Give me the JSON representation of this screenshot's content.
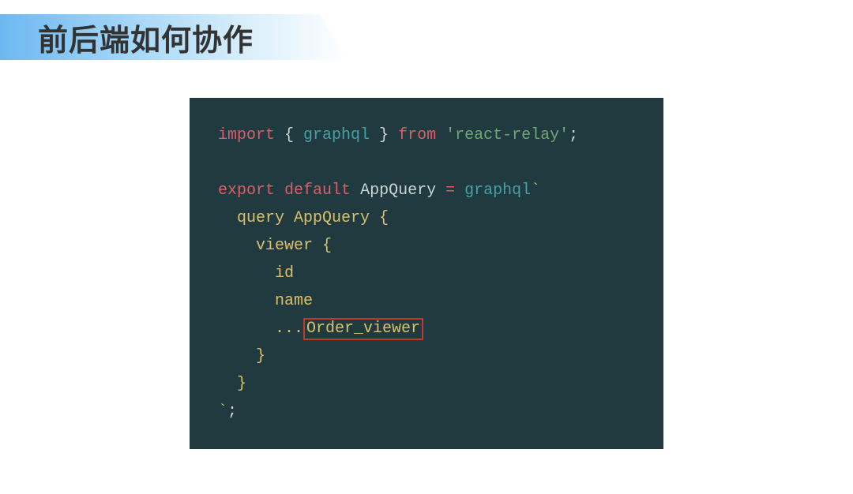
{
  "header": {
    "title": "前后端如何协作"
  },
  "code": {
    "line1_import": "import",
    "line1_brace_open": " { ",
    "line1_graphql": "graphql",
    "line1_brace_close": " } ",
    "line1_from": "from",
    "line1_space": " ",
    "line1_pkg": "'react-relay'",
    "line1_semi": ";",
    "line3_export": "export",
    "line3_sp1": " ",
    "line3_default": "default",
    "line3_sp2": " ",
    "line3_app": "AppQuery",
    "line3_sp3": " ",
    "line3_eq": "=",
    "line3_sp4": " ",
    "line3_gql": "graphql",
    "line3_tick": "`",
    "line4": "  query AppQuery {",
    "line5": "    viewer {",
    "line6": "      id",
    "line7": "      name",
    "line8_prefix": "      ...",
    "line8_frag": "Order_viewer",
    "line9": "    }",
    "line10": "  }",
    "line11_tick": "`",
    "line11_semi": ";"
  }
}
